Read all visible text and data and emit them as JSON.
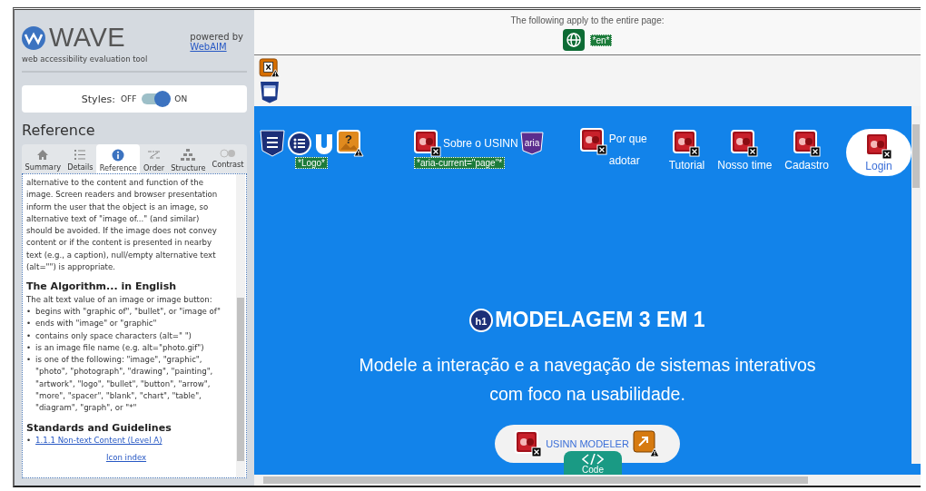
{
  "sidebar": {
    "logo": {
      "title": "WAVE",
      "subtitle": "web accessibility evaluation tool"
    },
    "powered_by": "powered by",
    "powered_link": "WebAIM",
    "styles": {
      "label": "Styles:",
      "off": "OFF",
      "on": "ON",
      "enabled": true
    },
    "heading": "Reference",
    "tabs": [
      {
        "label": "Summary",
        "kind": "home",
        "selected": false
      },
      {
        "label": "Details",
        "kind": "list",
        "selected": false
      },
      {
        "label": "Reference",
        "kind": "info",
        "selected": true
      },
      {
        "label": "Order",
        "kind": "order",
        "selected": false
      },
      {
        "label": "Structure",
        "kind": "structure",
        "selected": false
      },
      {
        "label": "Contrast",
        "kind": "contrast",
        "selected": false
      }
    ],
    "reference": {
      "paragraph": "alternative to the content and function of the image. Screen readers and browser presentation inform the user that the object is an image, so alternative text of \"image of...\" (and similar) should be avoided. If the image does not convey content or if the content is presented in nearby text (e.g., a caption), null/empty alternative text (alt=\"\") is appropriate.",
      "algorithm_heading": "The Algorithm... in English",
      "algorithm_intro": "The alt text value of an image or image button:",
      "rule_marker": "•",
      "rules": [
        "begins with \"graphic of\", \"bullet\", or \"image of\"",
        "ends with \"image\" or \"graphic\"",
        "contains only space characters (alt=\" \")",
        "is an image file name (e.g. alt=\"photo.gif\")",
        "is one of the following: \"image\", \"graphic\", \"photo\", \"photograph\", \"drawing\", \"painting\", \"artwork\", \"logo\", \"bullet\", \"button\", \"arrow\", \"more\", \"spacer\", \"blank\", \"chart\", \"table\", \"diagram\", \"graph\", or \"*\""
      ],
      "standards_heading": "Standards and Guidelines",
      "standard_marker": "•",
      "standards": [
        "1.1.1 Non-text Content (Level A)"
      ],
      "icon_index": "Icon index"
    }
  },
  "page": {
    "notice": "The following apply to the entire page:",
    "lang_tag": "*en*",
    "logo_tag": "*Logo*",
    "alert_glyph": "?",
    "nav": [
      {
        "label": "Sobre o USINN",
        "kind": "inline",
        "aria": "aria",
        "tag": "*aria-current=\"page\"*"
      },
      {
        "label": "Por que adotar",
        "kind": "wrap"
      },
      {
        "label": "Tutorial",
        "kind": "stack"
      },
      {
        "label": "Nosso time",
        "kind": "stack"
      },
      {
        "label": "Cadastro",
        "kind": "stack"
      },
      {
        "label": "Login",
        "kind": "pill"
      }
    ],
    "heading_tag": "h1",
    "heading": "MODELAGEM 3 EM 1",
    "subtitle": "Modele a interação e a navegação de sistemas interativos com foco na usabilidade.",
    "cta": "USINN MODELER",
    "code_tab": "Code"
  }
}
